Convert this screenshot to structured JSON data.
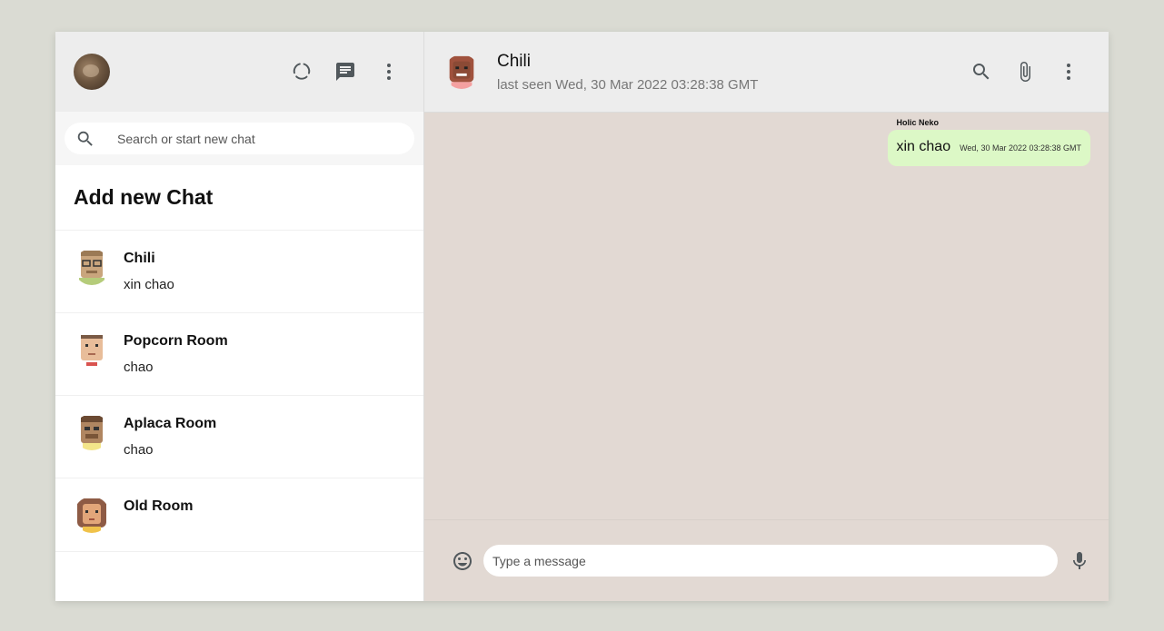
{
  "sidebar": {
    "search": {
      "placeholder": "Search or start new chat"
    },
    "add_chat_label": "Add new Chat",
    "chats": [
      {
        "name": "Chili",
        "last_message": "xin chao",
        "avatar_color": "#c9a57d"
      },
      {
        "name": "Popcorn Room",
        "last_message": "chao",
        "avatar_color": "#e8bd9a"
      },
      {
        "name": "Aplaca Room",
        "last_message": "chao",
        "avatar_color": "#b08661"
      },
      {
        "name": "Old Room",
        "last_message": "",
        "avatar_color": "#8e5b45"
      }
    ],
    "header_icons": [
      "status-icon",
      "new-chat-icon",
      "more-vert-icon"
    ]
  },
  "conversation": {
    "name": "Chili",
    "status": "last seen Wed, 30 Mar 2022 03:28:38 GMT",
    "header_icons": [
      "search-icon",
      "attach-icon",
      "more-vert-icon"
    ],
    "messages": [
      {
        "sender": "Holic Neko",
        "text": "xin chao",
        "time": "Wed, 30 Mar 2022 03:28:38 GMT"
      }
    ]
  },
  "composer": {
    "placeholder": "Type a message",
    "icons": [
      "emoji-icon",
      "mic-icon"
    ]
  },
  "colors": {
    "background": "#dadbd3",
    "header": "#ededed",
    "chat_bg": "#e2d9d3",
    "bubble": "#dcf8c6"
  }
}
